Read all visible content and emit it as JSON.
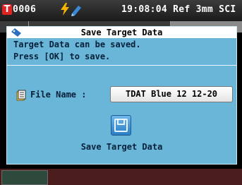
{
  "status_bar": {
    "target_badge": "T",
    "target_number": "0006",
    "bolt_icon": "lightning-icon",
    "pen_icon": "pen-icon",
    "time_info": "19:08:04 Ref 3mm SCI"
  },
  "dialog": {
    "title": "Save Target Data",
    "title_icon": "tag-icon",
    "message_line1": "Target Data can be saved.",
    "message_line2": "Press [OK] to save.",
    "file_name_icon": "file-icon",
    "file_name_label": "File Name :",
    "file_name_value": "TDAT Blue 12 12-20",
    "save_icon": "floppy-disk-icon",
    "save_label": "Save Target Data"
  },
  "colors": {
    "dialog_bg": "#6ab6d8",
    "status_badge": "#e52222",
    "footer": "#4a1c1c"
  }
}
